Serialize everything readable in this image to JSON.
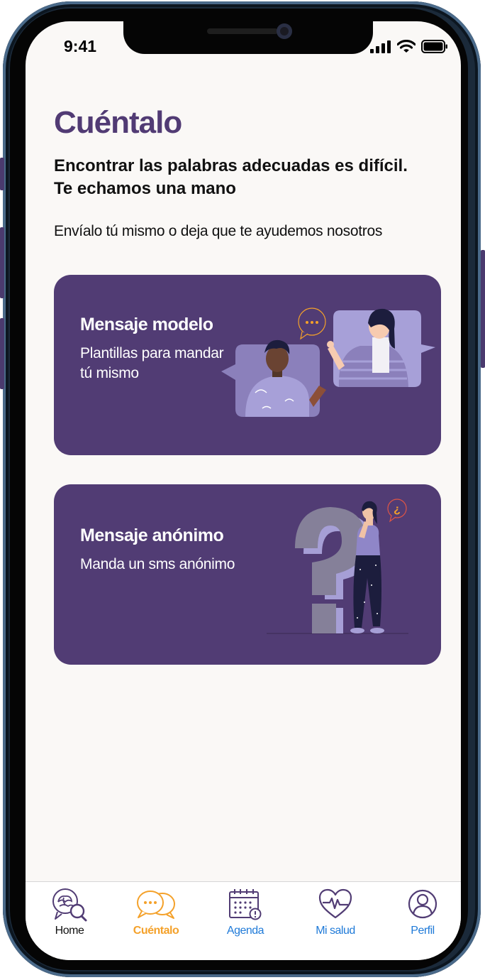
{
  "status_bar": {
    "time": "9:41"
  },
  "page": {
    "title": "Cuéntalo",
    "subtitle_line1": "Encontrar las palabras adecuadas es difícil.",
    "subtitle_line2": "Te echamos una mano",
    "intro": "Envíalo tú mismo o deja que te ayudemos nosotros"
  },
  "cards": [
    {
      "title": "Mensaje modelo",
      "desc_line1": "Plantillas para mandar",
      "desc_line2": "tú mismo",
      "illustration": "two-people-chatting"
    },
    {
      "title": "Mensaje anónimo",
      "desc_line1": "Manda un sms anónimo",
      "illustration": "woman-with-question-mark"
    }
  ],
  "question_glyph": "¿",
  "tabs": [
    {
      "label": "Home",
      "icon": "brain-search-icon",
      "active": false
    },
    {
      "label": "Cuéntalo",
      "icon": "chat-bubbles-icon",
      "active": true
    },
    {
      "label": "Agenda",
      "icon": "calendar-icon",
      "active": false
    },
    {
      "label": "Mi salud",
      "icon": "heart-pulse-icon",
      "active": false
    },
    {
      "label": "Perfil",
      "icon": "user-icon",
      "active": false
    }
  ],
  "colors": {
    "primary": "#513c74",
    "title": "#513b74",
    "active_tab": "#f4a12a",
    "tab_link": "#1f7ad8",
    "background": "#faf8f6"
  }
}
